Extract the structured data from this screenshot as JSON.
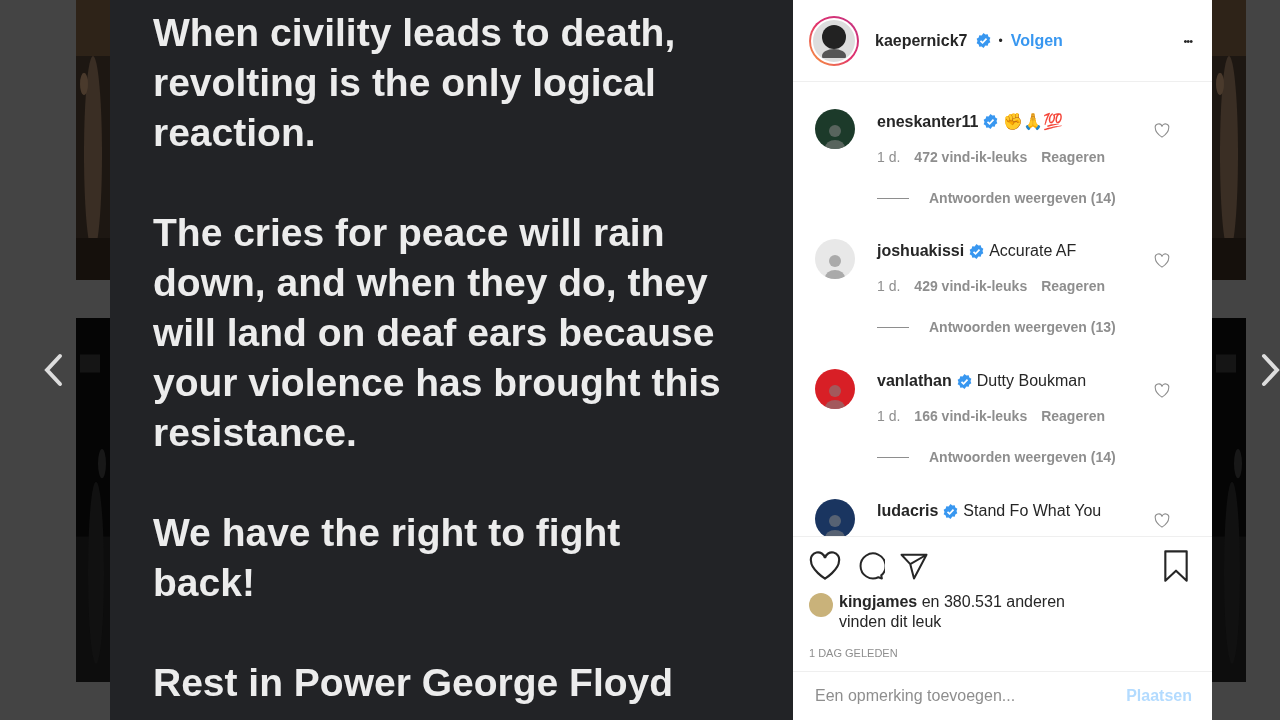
{
  "post": {
    "paragraphs": [
      "When civility leads to death,\nrevolting is the only logical\nreaction.",
      "The cries for peace will rain\ndown, and when they do, they\nwill land on deaf ears because\nyour violence has brought this\nresistance.",
      "We have the right to fight\nback!",
      "Rest in Power George Floyd"
    ]
  },
  "author": {
    "username": "kaepernick7",
    "verified": true,
    "separator": "•",
    "follow": "Volgen",
    "more": "•••"
  },
  "comments": [
    {
      "username": "eneskanter11",
      "verified": true,
      "text": "✊🙏💯",
      "time": "1 d.",
      "likes": "472 vind-ik-leuks",
      "reply": "Reageren",
      "view_replies": "Antwoorden weergeven (14)",
      "color": "#1c3a2a"
    },
    {
      "username": "joshuakissi",
      "verified": true,
      "text": "Accurate AF",
      "time": "1 d.",
      "likes": "429 vind-ik-leuks",
      "reply": "Reageren",
      "view_replies": "Antwoorden weergeven (13)",
      "color": "#e8e8e8"
    },
    {
      "username": "vanlathan",
      "verified": true,
      "text": "Dutty Boukman",
      "time": "1 d.",
      "likes": "166 vind-ik-leuks",
      "reply": "Reageren",
      "view_replies": "Antwoorden weergeven (14)",
      "color": "#d81f26"
    },
    {
      "username": "ludacris",
      "verified": true,
      "text": "Stand Fo What You",
      "color": "#1a3560"
    }
  ],
  "likes": {
    "user": "kingjames",
    "rest": "en 380.531 anderen",
    "line2": "vinden dit leuk"
  },
  "date": "1 DAG GELEDEN",
  "comment_box": {
    "placeholder": "Een opmerking toevoegen...",
    "post_button": "Plaatsen",
    "disabled": true
  }
}
